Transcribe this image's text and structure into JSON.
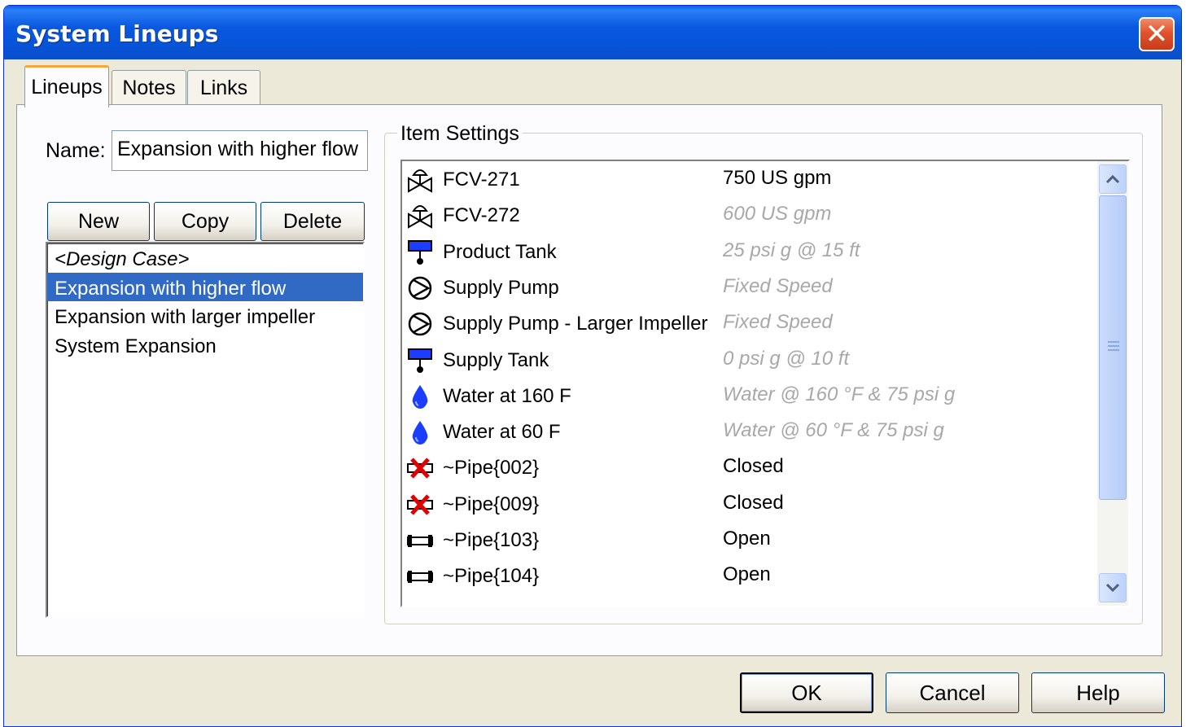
{
  "window": {
    "title": "System Lineups"
  },
  "tabs": [
    {
      "label": "Lineups",
      "active": true
    },
    {
      "label": "Notes",
      "active": false
    },
    {
      "label": "Links",
      "active": false
    }
  ],
  "name_field": {
    "label": "Name:",
    "value": "Expansion with higher flow"
  },
  "lineup_buttons": {
    "new": "New",
    "copy": "Copy",
    "delete": "Delete"
  },
  "lineups": [
    {
      "label": "<Design Case>",
      "style": "italic",
      "selected": false
    },
    {
      "label": "Expansion with higher flow",
      "selected": true
    },
    {
      "label": "Expansion with larger impeller",
      "selected": false
    },
    {
      "label": "System Expansion",
      "selected": false
    }
  ],
  "item_settings": {
    "title": "Item Settings",
    "items": [
      {
        "icon": "control-valve-icon",
        "name": "FCV-271",
        "value": "750 US gpm",
        "inherited": false
      },
      {
        "icon": "control-valve-icon",
        "name": "FCV-272",
        "value": "600 US gpm",
        "inherited": true
      },
      {
        "icon": "tank-icon",
        "name": "Product Tank",
        "value": "25 psi g @ 15 ft",
        "inherited": true
      },
      {
        "icon": "pump-icon",
        "name": "Supply Pump",
        "value": "Fixed Speed",
        "inherited": true
      },
      {
        "icon": "pump-icon",
        "name": "Supply Pump - Larger Impeller",
        "value": "Fixed Speed",
        "inherited": true
      },
      {
        "icon": "tank-icon",
        "name": "Supply Tank",
        "value": "0 psi g @ 10 ft",
        "inherited": true
      },
      {
        "icon": "fluid-drop-icon",
        "name": "Water at 160 F",
        "value": "Water @ 160 °F & 75 psi g",
        "inherited": true
      },
      {
        "icon": "fluid-drop-icon",
        "name": "Water at 60 F",
        "value": "Water @ 60 °F & 75 psi g",
        "inherited": true
      },
      {
        "icon": "closed-pipe-icon",
        "name": "~Pipe{002}",
        "value": "Closed",
        "inherited": false
      },
      {
        "icon": "closed-pipe-icon",
        "name": "~Pipe{009}",
        "value": "Closed",
        "inherited": false
      },
      {
        "icon": "open-pipe-icon",
        "name": "~Pipe{103}",
        "value": "Open",
        "inherited": false
      },
      {
        "icon": "open-pipe-icon",
        "name": "~Pipe{104}",
        "value": "Open",
        "inherited": false
      }
    ]
  },
  "dialog_buttons": {
    "ok": "OK",
    "cancel": "Cancel",
    "help": "Help"
  },
  "colors": {
    "title_bar": "#0a58e0",
    "selection": "#316ac5",
    "inherited_text": "#a8a8a8",
    "accent_blue": "#1a3dff",
    "close_red": "#e1532d"
  }
}
